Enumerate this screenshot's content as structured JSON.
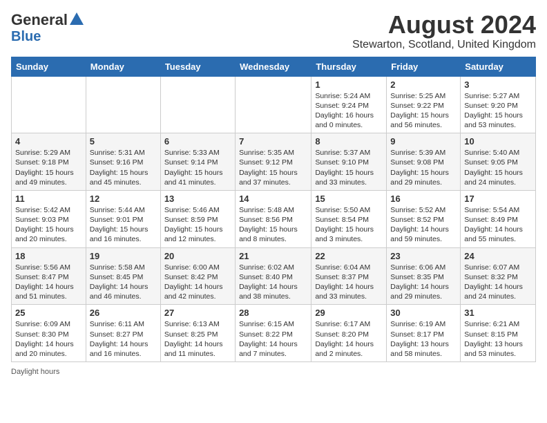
{
  "logo": {
    "general": "General",
    "blue": "Blue"
  },
  "title": "August 2024",
  "subtitle": "Stewarton, Scotland, United Kingdom",
  "footer": "Daylight hours",
  "days_of_week": [
    "Sunday",
    "Monday",
    "Tuesday",
    "Wednesday",
    "Thursday",
    "Friday",
    "Saturday"
  ],
  "weeks": [
    [
      {
        "day": "",
        "detail": ""
      },
      {
        "day": "",
        "detail": ""
      },
      {
        "day": "",
        "detail": ""
      },
      {
        "day": "",
        "detail": ""
      },
      {
        "day": "1",
        "detail": "Sunrise: 5:24 AM\nSunset: 9:24 PM\nDaylight: 16 hours\nand 0 minutes."
      },
      {
        "day": "2",
        "detail": "Sunrise: 5:25 AM\nSunset: 9:22 PM\nDaylight: 15 hours\nand 56 minutes."
      },
      {
        "day": "3",
        "detail": "Sunrise: 5:27 AM\nSunset: 9:20 PM\nDaylight: 15 hours\nand 53 minutes."
      }
    ],
    [
      {
        "day": "4",
        "detail": "Sunrise: 5:29 AM\nSunset: 9:18 PM\nDaylight: 15 hours\nand 49 minutes."
      },
      {
        "day": "5",
        "detail": "Sunrise: 5:31 AM\nSunset: 9:16 PM\nDaylight: 15 hours\nand 45 minutes."
      },
      {
        "day": "6",
        "detail": "Sunrise: 5:33 AM\nSunset: 9:14 PM\nDaylight: 15 hours\nand 41 minutes."
      },
      {
        "day": "7",
        "detail": "Sunrise: 5:35 AM\nSunset: 9:12 PM\nDaylight: 15 hours\nand 37 minutes."
      },
      {
        "day": "8",
        "detail": "Sunrise: 5:37 AM\nSunset: 9:10 PM\nDaylight: 15 hours\nand 33 minutes."
      },
      {
        "day": "9",
        "detail": "Sunrise: 5:39 AM\nSunset: 9:08 PM\nDaylight: 15 hours\nand 29 minutes."
      },
      {
        "day": "10",
        "detail": "Sunrise: 5:40 AM\nSunset: 9:05 PM\nDaylight: 15 hours\nand 24 minutes."
      }
    ],
    [
      {
        "day": "11",
        "detail": "Sunrise: 5:42 AM\nSunset: 9:03 PM\nDaylight: 15 hours\nand 20 minutes."
      },
      {
        "day": "12",
        "detail": "Sunrise: 5:44 AM\nSunset: 9:01 PM\nDaylight: 15 hours\nand 16 minutes."
      },
      {
        "day": "13",
        "detail": "Sunrise: 5:46 AM\nSunset: 8:59 PM\nDaylight: 15 hours\nand 12 minutes."
      },
      {
        "day": "14",
        "detail": "Sunrise: 5:48 AM\nSunset: 8:56 PM\nDaylight: 15 hours\nand 8 minutes."
      },
      {
        "day": "15",
        "detail": "Sunrise: 5:50 AM\nSunset: 8:54 PM\nDaylight: 15 hours\nand 3 minutes."
      },
      {
        "day": "16",
        "detail": "Sunrise: 5:52 AM\nSunset: 8:52 PM\nDaylight: 14 hours\nand 59 minutes."
      },
      {
        "day": "17",
        "detail": "Sunrise: 5:54 AM\nSunset: 8:49 PM\nDaylight: 14 hours\nand 55 minutes."
      }
    ],
    [
      {
        "day": "18",
        "detail": "Sunrise: 5:56 AM\nSunset: 8:47 PM\nDaylight: 14 hours\nand 51 minutes."
      },
      {
        "day": "19",
        "detail": "Sunrise: 5:58 AM\nSunset: 8:45 PM\nDaylight: 14 hours\nand 46 minutes."
      },
      {
        "day": "20",
        "detail": "Sunrise: 6:00 AM\nSunset: 8:42 PM\nDaylight: 14 hours\nand 42 minutes."
      },
      {
        "day": "21",
        "detail": "Sunrise: 6:02 AM\nSunset: 8:40 PM\nDaylight: 14 hours\nand 38 minutes."
      },
      {
        "day": "22",
        "detail": "Sunrise: 6:04 AM\nSunset: 8:37 PM\nDaylight: 14 hours\nand 33 minutes."
      },
      {
        "day": "23",
        "detail": "Sunrise: 6:06 AM\nSunset: 8:35 PM\nDaylight: 14 hours\nand 29 minutes."
      },
      {
        "day": "24",
        "detail": "Sunrise: 6:07 AM\nSunset: 8:32 PM\nDaylight: 14 hours\nand 24 minutes."
      }
    ],
    [
      {
        "day": "25",
        "detail": "Sunrise: 6:09 AM\nSunset: 8:30 PM\nDaylight: 14 hours\nand 20 minutes."
      },
      {
        "day": "26",
        "detail": "Sunrise: 6:11 AM\nSunset: 8:27 PM\nDaylight: 14 hours\nand 16 minutes."
      },
      {
        "day": "27",
        "detail": "Sunrise: 6:13 AM\nSunset: 8:25 PM\nDaylight: 14 hours\nand 11 minutes."
      },
      {
        "day": "28",
        "detail": "Sunrise: 6:15 AM\nSunset: 8:22 PM\nDaylight: 14 hours\nand 7 minutes."
      },
      {
        "day": "29",
        "detail": "Sunrise: 6:17 AM\nSunset: 8:20 PM\nDaylight: 14 hours\nand 2 minutes."
      },
      {
        "day": "30",
        "detail": "Sunrise: 6:19 AM\nSunset: 8:17 PM\nDaylight: 13 hours\nand 58 minutes."
      },
      {
        "day": "31",
        "detail": "Sunrise: 6:21 AM\nSunset: 8:15 PM\nDaylight: 13 hours\nand 53 minutes."
      }
    ]
  ]
}
